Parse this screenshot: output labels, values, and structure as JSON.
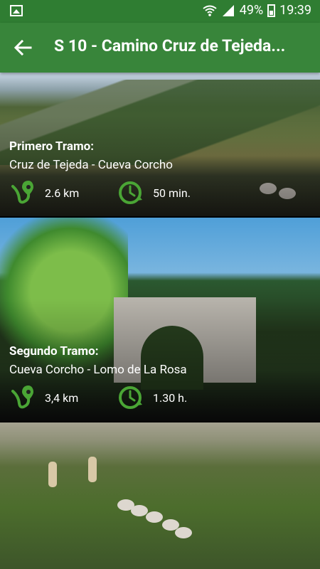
{
  "status": {
    "battery": "49%",
    "time": "19:39"
  },
  "header": {
    "title": "S 10 - Camino Cruz de Tejeda..."
  },
  "cards": [
    {
      "title": "Primero Tramo:",
      "route": "Cruz de Tejeda - Cueva Corcho",
      "distance": "2.6 km",
      "duration": "50 min."
    },
    {
      "title": "Segundo Tramo:",
      "route": "Cueva Corcho - Lomo de La Rosa",
      "distance": "3,4 km",
      "duration": "1.30 h."
    }
  ],
  "icons": {
    "status_left": "gallery-icon",
    "wifi": "wifi-icon",
    "signal": "signal-icon",
    "battery": "battery-icon",
    "back": "back-arrow-icon",
    "distance": "route-icon",
    "duration": "clock-icon"
  },
  "colors": {
    "app_bar": "#38853a",
    "status_bar": "#2f7d32",
    "accent": "#4aa535"
  }
}
